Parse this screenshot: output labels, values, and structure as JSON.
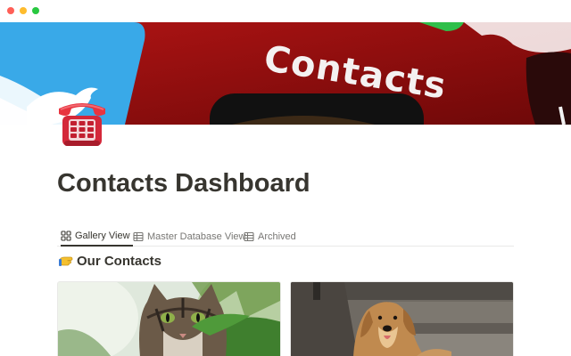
{
  "window": {
    "controls": [
      "close",
      "minimize",
      "zoom"
    ]
  },
  "cover": {
    "text": "Contacts"
  },
  "page": {
    "icon": "telephone-icon",
    "title": "Contacts Dashboard"
  },
  "tabs": [
    {
      "label": "Gallery View",
      "icon": "gallery-icon",
      "active": true
    },
    {
      "label": "Master Database View",
      "icon": "table-icon",
      "active": false
    },
    {
      "label": "Archived",
      "icon": "table-icon",
      "active": false
    }
  ],
  "section": {
    "heading": "Our Contacts",
    "icon": "pointing-hand-icon"
  },
  "cards": [
    {
      "image": "cat-photo"
    },
    {
      "image": "dog-photo"
    }
  ],
  "colors": {
    "text": "#37352f",
    "muted": "#787774",
    "cover_red": "#8f0d0d",
    "cover_blue": "#39a9e8",
    "phone_red": "#d4283a"
  }
}
